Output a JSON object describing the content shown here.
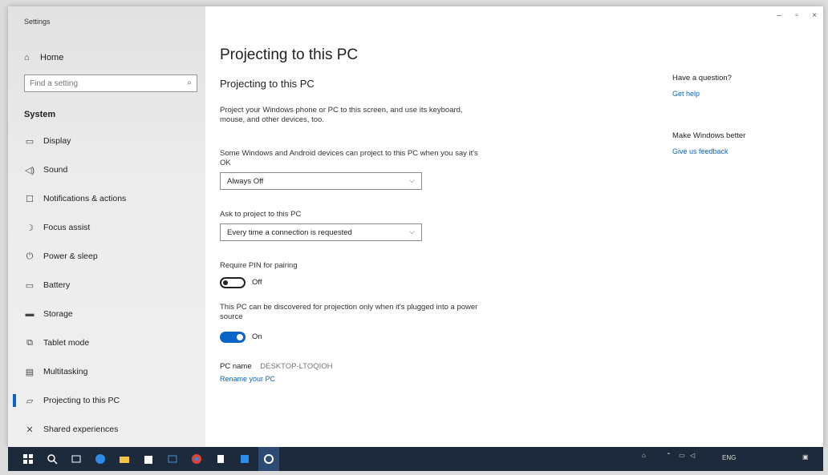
{
  "window": {
    "app_title": "Settings",
    "controls": {
      "minimize": "–",
      "maximize": "▫",
      "close": "×"
    }
  },
  "sidebar": {
    "home_label": "Home",
    "search_placeholder": "Find a setting",
    "section_label": "System",
    "items": [
      {
        "label": "Display",
        "icon": "display-icon",
        "glyph": "▭"
      },
      {
        "label": "Sound",
        "icon": "sound-icon",
        "glyph": "◁)"
      },
      {
        "label": "Notifications & actions",
        "icon": "notifications-icon",
        "glyph": "☐"
      },
      {
        "label": "Focus assist",
        "icon": "focus-assist-icon",
        "glyph": "☽"
      },
      {
        "label": "Power & sleep",
        "icon": "power-icon",
        "glyph": "⏻"
      },
      {
        "label": "Battery",
        "icon": "battery-icon",
        "glyph": "▭"
      },
      {
        "label": "Storage",
        "icon": "storage-icon",
        "glyph": "▬"
      },
      {
        "label": "Tablet mode",
        "icon": "tablet-mode-icon",
        "glyph": "⧉"
      },
      {
        "label": "Multitasking",
        "icon": "multitasking-icon",
        "glyph": "▤"
      },
      {
        "label": "Projecting to this PC",
        "icon": "projecting-icon",
        "glyph": "▱",
        "active": true
      },
      {
        "label": "Shared experiences",
        "icon": "shared-experiences-icon",
        "glyph": "✕"
      }
    ]
  },
  "main": {
    "page_title": "Projecting to this PC",
    "section_title": "Projecting to this PC",
    "description": "Project your Windows phone or PC to this screen, and use its keyboard, mouse, and other devices, too.",
    "setting1_label": "Some Windows and Android devices can project to this PC when you say it's OK",
    "setting1_value": "Always Off",
    "setting2_label": "Ask to project to this PC",
    "setting2_value": "Every time a connection is requested",
    "pin_label": "Require PIN for pairing",
    "pin_state": "Off",
    "pin_on": false,
    "power_label": "This PC can be discovered for projection only when it's plugged into a power source",
    "power_state": "On",
    "power_on": true,
    "pc_name_label": "PC name",
    "pc_name_value": "DESKTOP-LTOQIOH",
    "rename_link": "Rename your PC"
  },
  "right_panel": {
    "question_title": "Have a question?",
    "help_link": "Get help",
    "better_title": "Make Windows better",
    "feedback_link": "Give us feedback"
  },
  "taskbar": {
    "colors": {
      "background": "#1c2a3c",
      "accent": "#0a64c8"
    },
    "tray_lang": "ENG"
  }
}
